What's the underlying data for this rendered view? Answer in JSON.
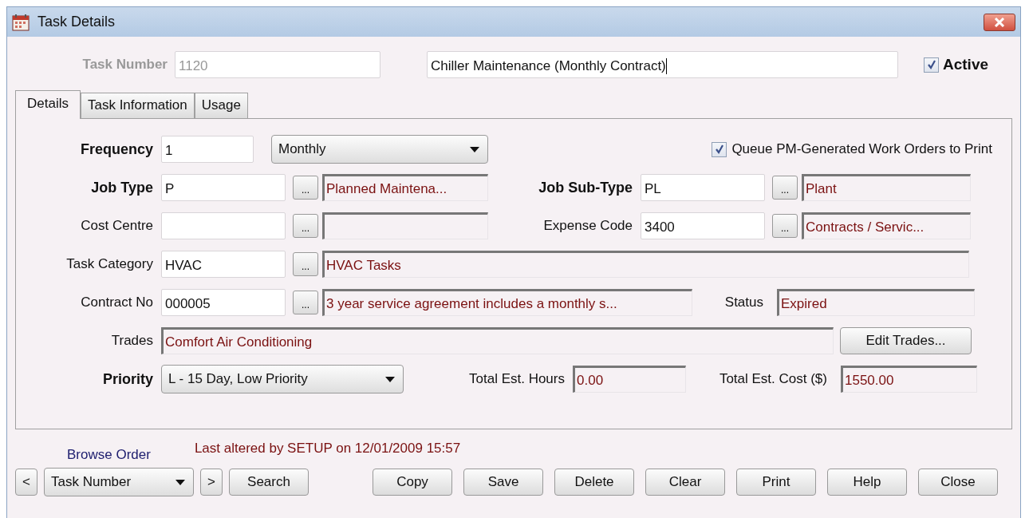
{
  "window": {
    "title": "Task Details"
  },
  "task_number": {
    "label": "Task Number",
    "value": "1120",
    "disabled": true
  },
  "task_name": {
    "value": "Chiller Maintenance (Monthly Contract)"
  },
  "active": {
    "label": "Active",
    "checked": true
  },
  "tabs": [
    {
      "label": "Details",
      "selected": true
    },
    {
      "label": "Task Information",
      "selected": false
    },
    {
      "label": "Usage",
      "selected": false
    }
  ],
  "frequency": {
    "label": "Frequency",
    "required": true,
    "value": "1",
    "period": "Monthly"
  },
  "queue_print": {
    "label": "Queue PM-Generated Work Orders to Print",
    "checked": true
  },
  "lookups": [
    {
      "label": "Job Type",
      "required": true,
      "code": "P",
      "button": "...",
      "description": "Planned Maintena..."
    },
    {
      "label": "Job Sub-Type",
      "required": true,
      "code": "PL",
      "button": "...",
      "description": "Plant"
    },
    {
      "label": "Cost Centre",
      "required": false,
      "button": "..."
    },
    {
      "label": "Expense Code",
      "required": false,
      "code": "3400",
      "button": "...",
      "description": "Contracts / Servic..."
    },
    {
      "label": "Task Category",
      "required": false,
      "code": "HVAC",
      "button": "...",
      "description": "HVAC Tasks"
    },
    {
      "label": "Contract No",
      "required": false,
      "code": "000005",
      "button": "...",
      "description": "3 year service agreement includes a monthly s..."
    }
  ],
  "status": {
    "label": "Status",
    "value": "Expired"
  },
  "trades": {
    "label": "Trades",
    "value": "Comfort Air Conditioning",
    "button": "Edit Trades..."
  },
  "priority": {
    "label": "Priority",
    "required": true,
    "value": "L - 15 Day, Low Priority"
  },
  "total_hours": {
    "label": "Total Est. Hours",
    "value": "0.00"
  },
  "total_cost": {
    "label": "Total Est. Cost ($)",
    "value": "1550.00"
  },
  "browse_order": {
    "label": "Browse Order",
    "prev": "<",
    "value": "Task Number",
    "next": ">",
    "search": "Search"
  },
  "last_altered": "Last altered by SETUP on 12/01/2009 15:57",
  "buttons": [
    "Copy",
    "Save",
    "Delete",
    "Clear",
    "Print",
    "Help",
    "Close"
  ]
}
